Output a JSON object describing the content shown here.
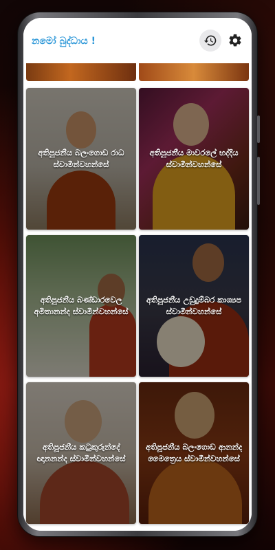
{
  "app": {
    "title": "නමෝ බුද්ධාය !"
  },
  "toolbar": {
    "history_icon": "history-icon",
    "settings_icon": "gear-icon"
  },
  "theme": {
    "title_color": "#2c97d8",
    "card_text_color": "#ffffff"
  },
  "monks": [
    {
      "name": "අතිපූජනීය බලංගොඩ රාධ ස්වාමීන්වහන්සේ"
    },
    {
      "name": "අතිපූජනීය මාවරලේ භද්දිය ස්වාමීන්වහන්සේ"
    },
    {
      "name": "අතිපූජනීය බණ්ඩාරවෙල අමිතානන්ද ස්වාමීන්වහන්සේ"
    },
    {
      "name": "අතිපූජනීය උඩුදුම්බර කාශ්‍යප ස්වාමීන්වහන්සේ"
    },
    {
      "name": "අතිපූජනීය කටුකුරුන්දේ ඥානනන්ද ස්වාමීන්වහන්සේ"
    },
    {
      "name": "අතිපූජනීය බලංගොඩ ආනන්ද මෛත්‍රෙය ස්වාමීන්වහන්සේ"
    }
  ]
}
